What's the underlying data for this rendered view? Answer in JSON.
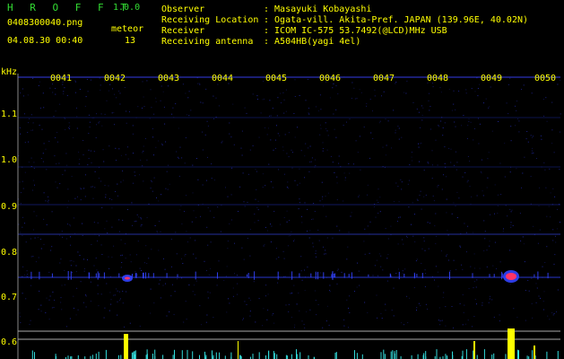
{
  "app": {
    "title": "H R O F F T",
    "version": "1.0.0",
    "filename": "0408300040.png",
    "datetime": "04.08.30 00:40",
    "meteor_label": "meteor",
    "meteor_count": "13"
  },
  "info": [
    {
      "label": "Observer",
      "value": ": Masayuki Kobayashi"
    },
    {
      "label": "Receiving Location",
      "value": ": Ogata-vill. Akita-Pref. JAPAN (139.96E, 40.02N)"
    },
    {
      "label": "Receiver",
      "value": ": ICOM IC-575 53.7492(@LCD)MHz USB"
    },
    {
      "label": "Receiving antenna",
      "value": ": A504HB(yagi 4el)"
    }
  ],
  "axis": {
    "unit": "kHz",
    "time_ticks": [
      "0041",
      "0042",
      "0043",
      "0044",
      "0045",
      "0046",
      "0047",
      "0048",
      "0049",
      "0050"
    ],
    "freq_ticks": [
      "1.1",
      "1.0",
      "0.9",
      "0.8",
      "0.7",
      "0.6"
    ]
  },
  "colors": {
    "background": "#000000",
    "title_green": "#33dd33",
    "label_yellow": "#ffff00",
    "echo_blue": "#3344ff",
    "histogram_yellow": "#ffff00",
    "histogram_cyan": "#33dddd"
  }
}
